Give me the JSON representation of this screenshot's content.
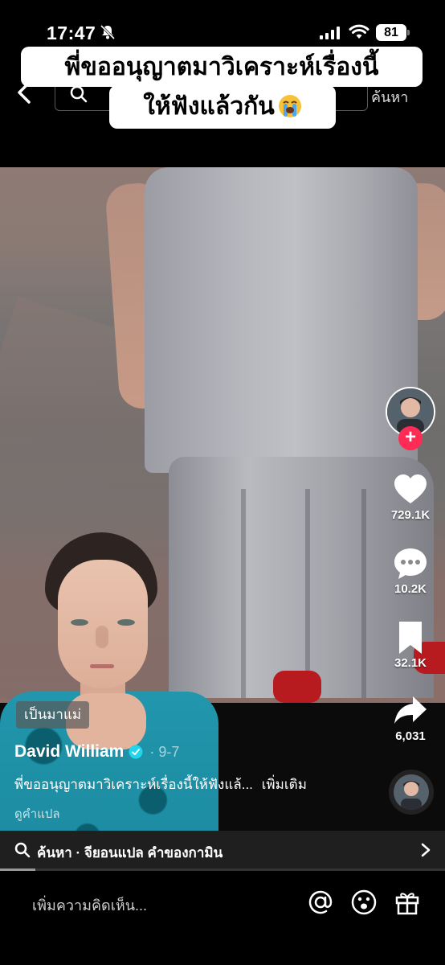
{
  "status_bar": {
    "time": "17:47",
    "battery": "81"
  },
  "caption": {
    "line1": "พี่ขออนุญาตมาวิเคราะห์เรื่องนี้",
    "line2": "ให้ฟังแล้วกัน"
  },
  "top_nav": {
    "search_button": "ค้นหา"
  },
  "actions": {
    "likes": "729.1K",
    "comments": "10.2K",
    "bookmarks": "32.1K",
    "shares": "6,031"
  },
  "post": {
    "tag": "เป็นมาแม่",
    "username": "David William",
    "date": "· 9-7",
    "description": "พี่ขออนุญาตมาวิเคราะห์เรื่องนี้ให้ฟังแล้... ",
    "more": "เพิ่มเติม",
    "translate": "ดูคำแปล"
  },
  "search_suggestion": {
    "text": "ค้นหา · จียอนแปล คำของกามิน"
  },
  "comment_bar": {
    "placeholder": "เพิ่มความคิดเห็น..."
  },
  "playback": {
    "progress_fraction": 0.08
  },
  "colors": {
    "follow": "#fe2c55",
    "verified": "#20d5ec"
  }
}
